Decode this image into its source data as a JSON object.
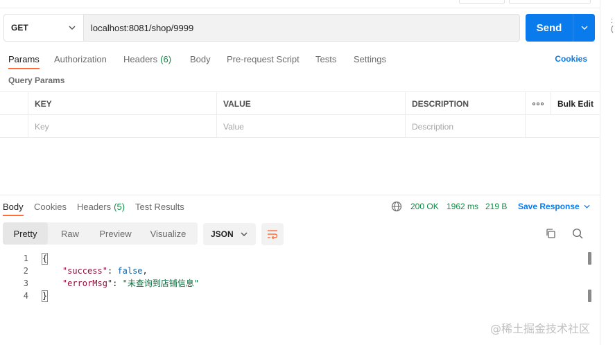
{
  "request": {
    "method": "GET",
    "url": "localhost:8081/shop/9999",
    "send_label": "Send"
  },
  "request_tabs": [
    {
      "label": "Params",
      "active": true
    },
    {
      "label": "Authorization"
    },
    {
      "label": "Headers",
      "count": "(6)"
    },
    {
      "label": "Body"
    },
    {
      "label": "Pre-request Script"
    },
    {
      "label": "Tests"
    },
    {
      "label": "Settings"
    }
  ],
  "cookies_link": "Cookies",
  "query_params": {
    "title": "Query Params",
    "columns": [
      "KEY",
      "VALUE",
      "DESCRIPTION"
    ],
    "bulk_edit": "Bulk Edit",
    "placeholders": {
      "key": "Key",
      "value": "Value",
      "description": "Description"
    }
  },
  "response_tabs": [
    {
      "label": "Body",
      "active": true
    },
    {
      "label": "Cookies"
    },
    {
      "label": "Headers",
      "count": "(5)"
    },
    {
      "label": "Test Results"
    }
  ],
  "response_status": {
    "status": "200 OK",
    "time": "1962 ms",
    "size": "219 B",
    "save_label": "Save Response"
  },
  "view_modes": [
    "Pretty",
    "Raw",
    "Preview",
    "Visualize"
  ],
  "active_view_mode": "Pretty",
  "format": "JSON",
  "code_lines": [
    {
      "n": "1",
      "text": "{"
    },
    {
      "n": "2",
      "key": "\"success\"",
      "sep": ": ",
      "val": "false",
      "end": ","
    },
    {
      "n": "3",
      "key": "\"errorMsg\"",
      "sep": ": ",
      "str": "\"未查询到店铺信息\""
    },
    {
      "n": "4",
      "text": "}"
    }
  ],
  "right_edge_glyph": ":(",
  "watermark": "@稀土掘金技术社区",
  "colors": {
    "accent": "#097bed",
    "tab_indicator": "#ff6c37",
    "status_ok": "#0f8a44"
  },
  "icons": [
    "chevron-down-icon",
    "more-dots-icon",
    "globe-icon",
    "wrap-lines-icon",
    "copy-icon",
    "search-icon"
  ]
}
